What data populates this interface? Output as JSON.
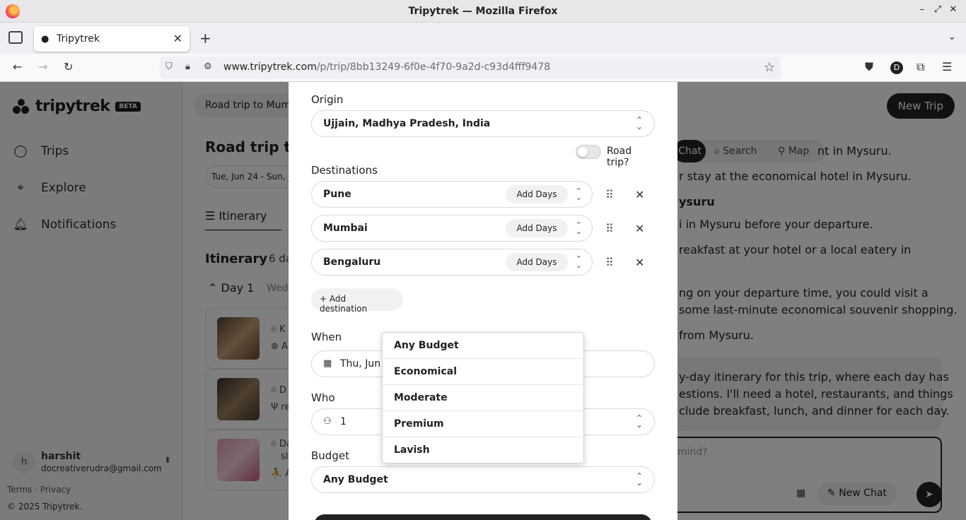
{
  "browser": {
    "window_title": "Tripytrek — Mozilla Firefox",
    "tab_title": "Tripytrek",
    "url_domain": "www.tripytrek.com",
    "url_path": "/p/trip/8bb13249-6f0e-4f70-9a2d-c93d4fff9478"
  },
  "sidebar": {
    "logo": "tripytrek",
    "badge": "BETA",
    "items": [
      {
        "label": "Trips",
        "icon": "chat-bubble-icon"
      },
      {
        "label": "Explore",
        "icon": "telescope-icon"
      },
      {
        "label": "Notifications",
        "icon": "bell-icon"
      }
    ],
    "user": {
      "initial": "h",
      "name": "harshit",
      "email": "docreativerudra@gmail.com"
    },
    "legal": "Terms · Privacy",
    "copyright": "© 2025 Tripytrek."
  },
  "main": {
    "trip_chip": "Road trip to Mumb",
    "new_trip": "New Trip",
    "trip_title": "Road trip to M",
    "dates": "Tue, Jun 24 - Sun, Jun",
    "tab_itinerary": "Itinerary",
    "itinerary_heading": "Itinerary",
    "itinerary_days": "6 da",
    "day1": "Day 1",
    "day1_sub": "Wed,",
    "card_lines": [
      {
        "a": "K",
        "b": "A"
      },
      {
        "a": "D",
        "b": "re"
      },
      {
        "a": "Da",
        "a2": "sl",
        "b": "A"
      }
    ]
  },
  "chat": {
    "toggle": {
      "chat": "Chat",
      "search": "Search",
      "map": "Map"
    },
    "lines": [
      "nt in Mysuru.",
      "r stay at the economical hotel in Mysuru.",
      "ysuru",
      "i in Mysuru before your departure.",
      "reakfast at your hotel or a local eatery in",
      "ng on your departure time, you could visit a",
      "some last-minute economical souvenir shopping.",
      "from Mysuru."
    ],
    "user_message": [
      "y-day itinerary for this trip, where each day has",
      "estions. I'll need a hotel, restaurants, and things",
      "clude breakfast, lunch, and dinner for each day."
    ],
    "input_placeholder": "mind?",
    "new_chat": "New Chat"
  },
  "modal": {
    "origin_label": "Origin",
    "origin_value": "Ujjain, Madhya Pradesh, India",
    "road_trip_label": "Road trip?",
    "road_trip_on": false,
    "destinations_label": "Destinations",
    "destinations": [
      {
        "name": "Pune",
        "add_days": "Add Days"
      },
      {
        "name": "Mumbai",
        "add_days": "Add Days"
      },
      {
        "name": "Bengaluru",
        "add_days": "Add Days"
      }
    ],
    "add_destination": "+ Add destination",
    "when_label": "When",
    "when_value": "Thu, Jun",
    "who_label": "Who",
    "who_value": "1",
    "budget_label": "Budget",
    "budget_value": "Any Budget",
    "budget_options": [
      "Any Budget",
      "Economical",
      "Moderate",
      "Premium",
      "Lavish"
    ]
  },
  "colors": {
    "brand_dark": "#222222",
    "overlay": "rgba(0,0,0,0.5)"
  }
}
